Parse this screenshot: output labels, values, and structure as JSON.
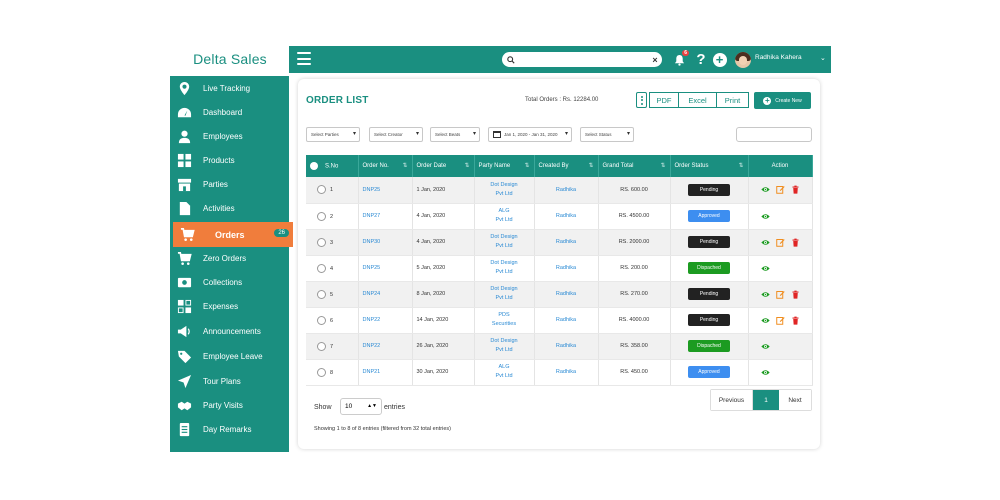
{
  "brand": "Delta Sales",
  "colors": {
    "primary": "#1a8f80",
    "active": "#f07d3c",
    "pending": "#222222",
    "approved": "#3d8ef0",
    "dispatched": "#1c9b21"
  },
  "sidebar": {
    "items": [
      {
        "label": "Live Tracking",
        "icon": "location-pin-icon"
      },
      {
        "label": "Dashboard",
        "icon": "dashboard-gauge-icon"
      },
      {
        "label": "Employees",
        "icon": "user-icon"
      },
      {
        "label": "Products",
        "icon": "grid-icon"
      },
      {
        "label": "Parties",
        "icon": "store-icon"
      },
      {
        "label": "Activities",
        "icon": "document-icon"
      },
      {
        "label": "Orders",
        "icon": "cart-icon",
        "badge": "26",
        "active": true
      },
      {
        "label": "Zero Orders",
        "icon": "cart-icon"
      },
      {
        "label": "Collections",
        "icon": "money-icon"
      },
      {
        "label": "Expenses",
        "icon": "expenses-icon"
      },
      {
        "label": "Announcements",
        "icon": "megaphone-icon"
      },
      {
        "label": "Employee Leave",
        "icon": "tag-icon"
      },
      {
        "label": "Tour Plans",
        "icon": "navigation-arrow-icon"
      },
      {
        "label": "Party Visits",
        "icon": "handshake-icon"
      },
      {
        "label": "Day Remarks",
        "icon": "notepad-icon"
      }
    ]
  },
  "topbar": {
    "search_placeholder": "",
    "notification_count": "6",
    "help": "?",
    "plus": "+",
    "user_name": "Radhika Kahera"
  },
  "page": {
    "title": "ORDER LIST",
    "total_orders": "Total Orders : Rs. 12284.00",
    "export": {
      "pdf": "PDF",
      "excel": "Excel",
      "print": "Print"
    },
    "create_button": "Create New",
    "filters": {
      "parties": "Select Parties",
      "creator": "Select Creator",
      "beats": "Select Beats",
      "date_range": "Jan 1, 2020 - Jan 31, 2020",
      "status": "Select Status"
    }
  },
  "table": {
    "headers": [
      "S.No",
      "Order No.",
      "Order Date",
      "Party Name",
      "Created By",
      "Grand Total",
      "Order Status",
      "Action"
    ],
    "rows": [
      {
        "sno": "1",
        "order_no": "DNP25",
        "date": "1 Jan, 2020",
        "party": [
          "Dot Design",
          "Pvt Ltd"
        ],
        "created_by": "Radhika",
        "total": "RS. 600.00",
        "status": "Pending",
        "status_type": "pending",
        "actions": [
          "view",
          "edit",
          "delete"
        ]
      },
      {
        "sno": "2",
        "order_no": "DNP27",
        "date": "4 Jan, 2020",
        "party": [
          "ALG",
          "Pvt Ltd"
        ],
        "created_by": "Radhika",
        "total": "RS. 4500.00",
        "status": "Approved",
        "status_type": "approved",
        "actions": [
          "view"
        ]
      },
      {
        "sno": "3",
        "order_no": "DNP30",
        "date": "4 Jan, 2020",
        "party": [
          "Dot Design",
          "Pvt Ltd"
        ],
        "created_by": "Radhika",
        "total": "RS. 2000.00",
        "status": "Pending",
        "status_type": "pending",
        "actions": [
          "view",
          "edit",
          "delete"
        ]
      },
      {
        "sno": "4",
        "order_no": "DNP25",
        "date": "5 Jan, 2020",
        "party": [
          "Dot Design",
          "Pvt Ltd"
        ],
        "created_by": "Radhika",
        "total": "RS. 200.00",
        "status": "Dispached",
        "status_type": "dispatched",
        "actions": [
          "view"
        ]
      },
      {
        "sno": "5",
        "order_no": "DNP24",
        "date": "8 Jan, 2020",
        "party": [
          "Dot Design",
          "Pvt Ltd"
        ],
        "created_by": "Radhika",
        "total": "RS. 270.00",
        "status": "Pending",
        "status_type": "pending",
        "actions": [
          "view",
          "edit",
          "delete"
        ]
      },
      {
        "sno": "6",
        "order_no": "DNP22",
        "date": "14 Jan, 2020",
        "party": [
          "PDS",
          "Securities"
        ],
        "created_by": "Radhika",
        "total": "RS. 4000.00",
        "status": "Pending",
        "status_type": "pending",
        "actions": [
          "view",
          "edit",
          "delete"
        ]
      },
      {
        "sno": "7",
        "order_no": "DNP22",
        "date": "26 Jan, 2020",
        "party": [
          "Dot Design",
          "Pvt Ltd"
        ],
        "created_by": "Radhika",
        "total": "RS. 358.00",
        "status": "Dispached",
        "status_type": "dispatched",
        "actions": [
          "view"
        ]
      },
      {
        "sno": "8",
        "order_no": "DNP21",
        "date": "30 Jan, 2020",
        "party": [
          "ALG",
          "Pvt Ltd"
        ],
        "created_by": "Radhika",
        "total": "RS. 450.00",
        "status": "Approved",
        "status_type": "approved",
        "actions": [
          "view"
        ]
      }
    ]
  },
  "footer": {
    "show_label": "Show",
    "show_value": "10",
    "entries_label": "entries",
    "showing_text": "Showing 1 to 8 of 8 entries (filtered from 32 total entries)",
    "pagination": {
      "previous": "Previous",
      "current": "1",
      "next": "Next"
    }
  }
}
